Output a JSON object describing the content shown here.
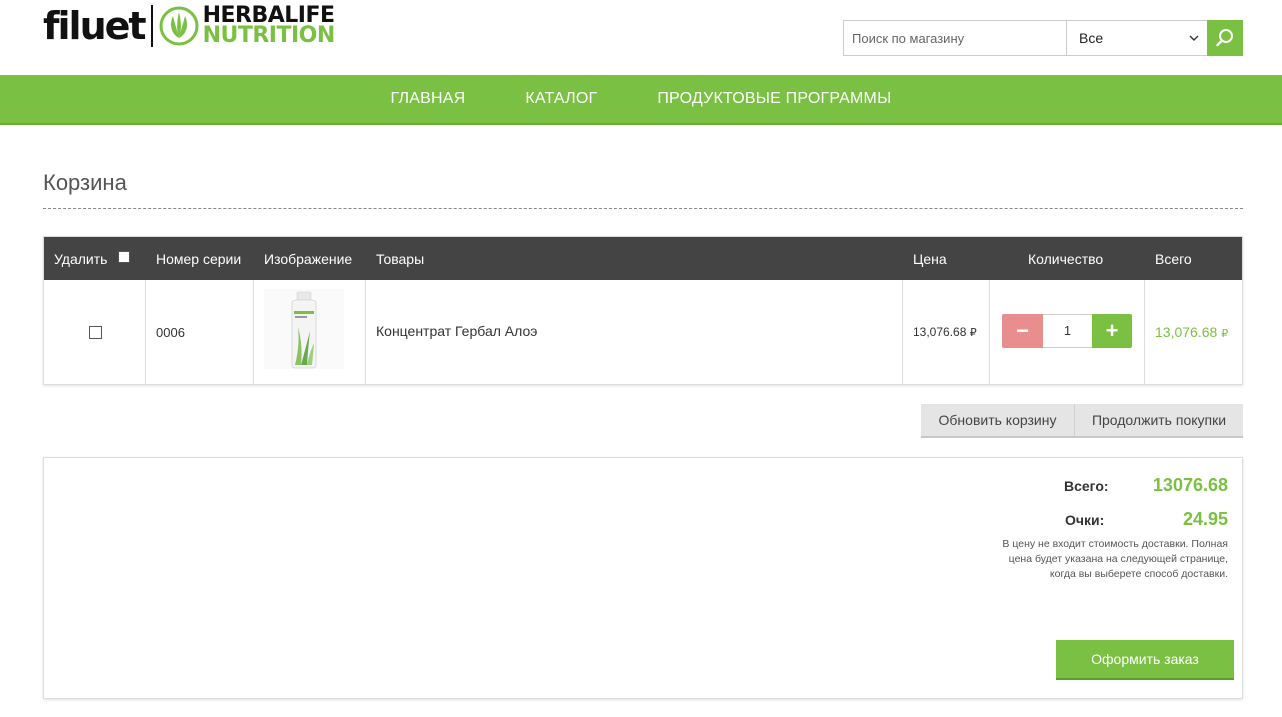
{
  "header": {
    "logo_left": "filuet",
    "logo_brand_top": "HERBALIFE",
    "logo_brand_bottom": "NUTRITION",
    "search_placeholder": "Поиск по магазину",
    "search_scope": "Все",
    "brand_color": "#7ac143"
  },
  "nav": {
    "items": [
      "ГЛАВНАЯ",
      "КАТАЛОГ",
      "ПРОДУКТОВЫЕ ПРОГРАММЫ"
    ]
  },
  "page": {
    "title": "Корзина"
  },
  "cart": {
    "columns": {
      "delete": "Удалить",
      "sku": "Номер серии",
      "image": "Изображение",
      "product": "Товары",
      "price": "Цена",
      "quantity": "Количество",
      "total": "Всего"
    },
    "rows": [
      {
        "sku": "0006",
        "name": "Концентрат Гербал Алоэ",
        "price": "13,076.68",
        "quantity": "1",
        "total": "13,076.68",
        "currency_icon": "ruble-icon"
      }
    ],
    "update_label": "Обновить корзину",
    "continue_label": "Продолжить покупки"
  },
  "summary": {
    "total_label": "Всего:",
    "total_value": "13076.68",
    "points_label": "Очки:",
    "points_value": "24.95",
    "note": "В цену не входит стоимость доставки. Полная цена будет указана на следующей странице, когда вы выберете способ доставки.",
    "checkout_label": "Оформить заказ"
  }
}
